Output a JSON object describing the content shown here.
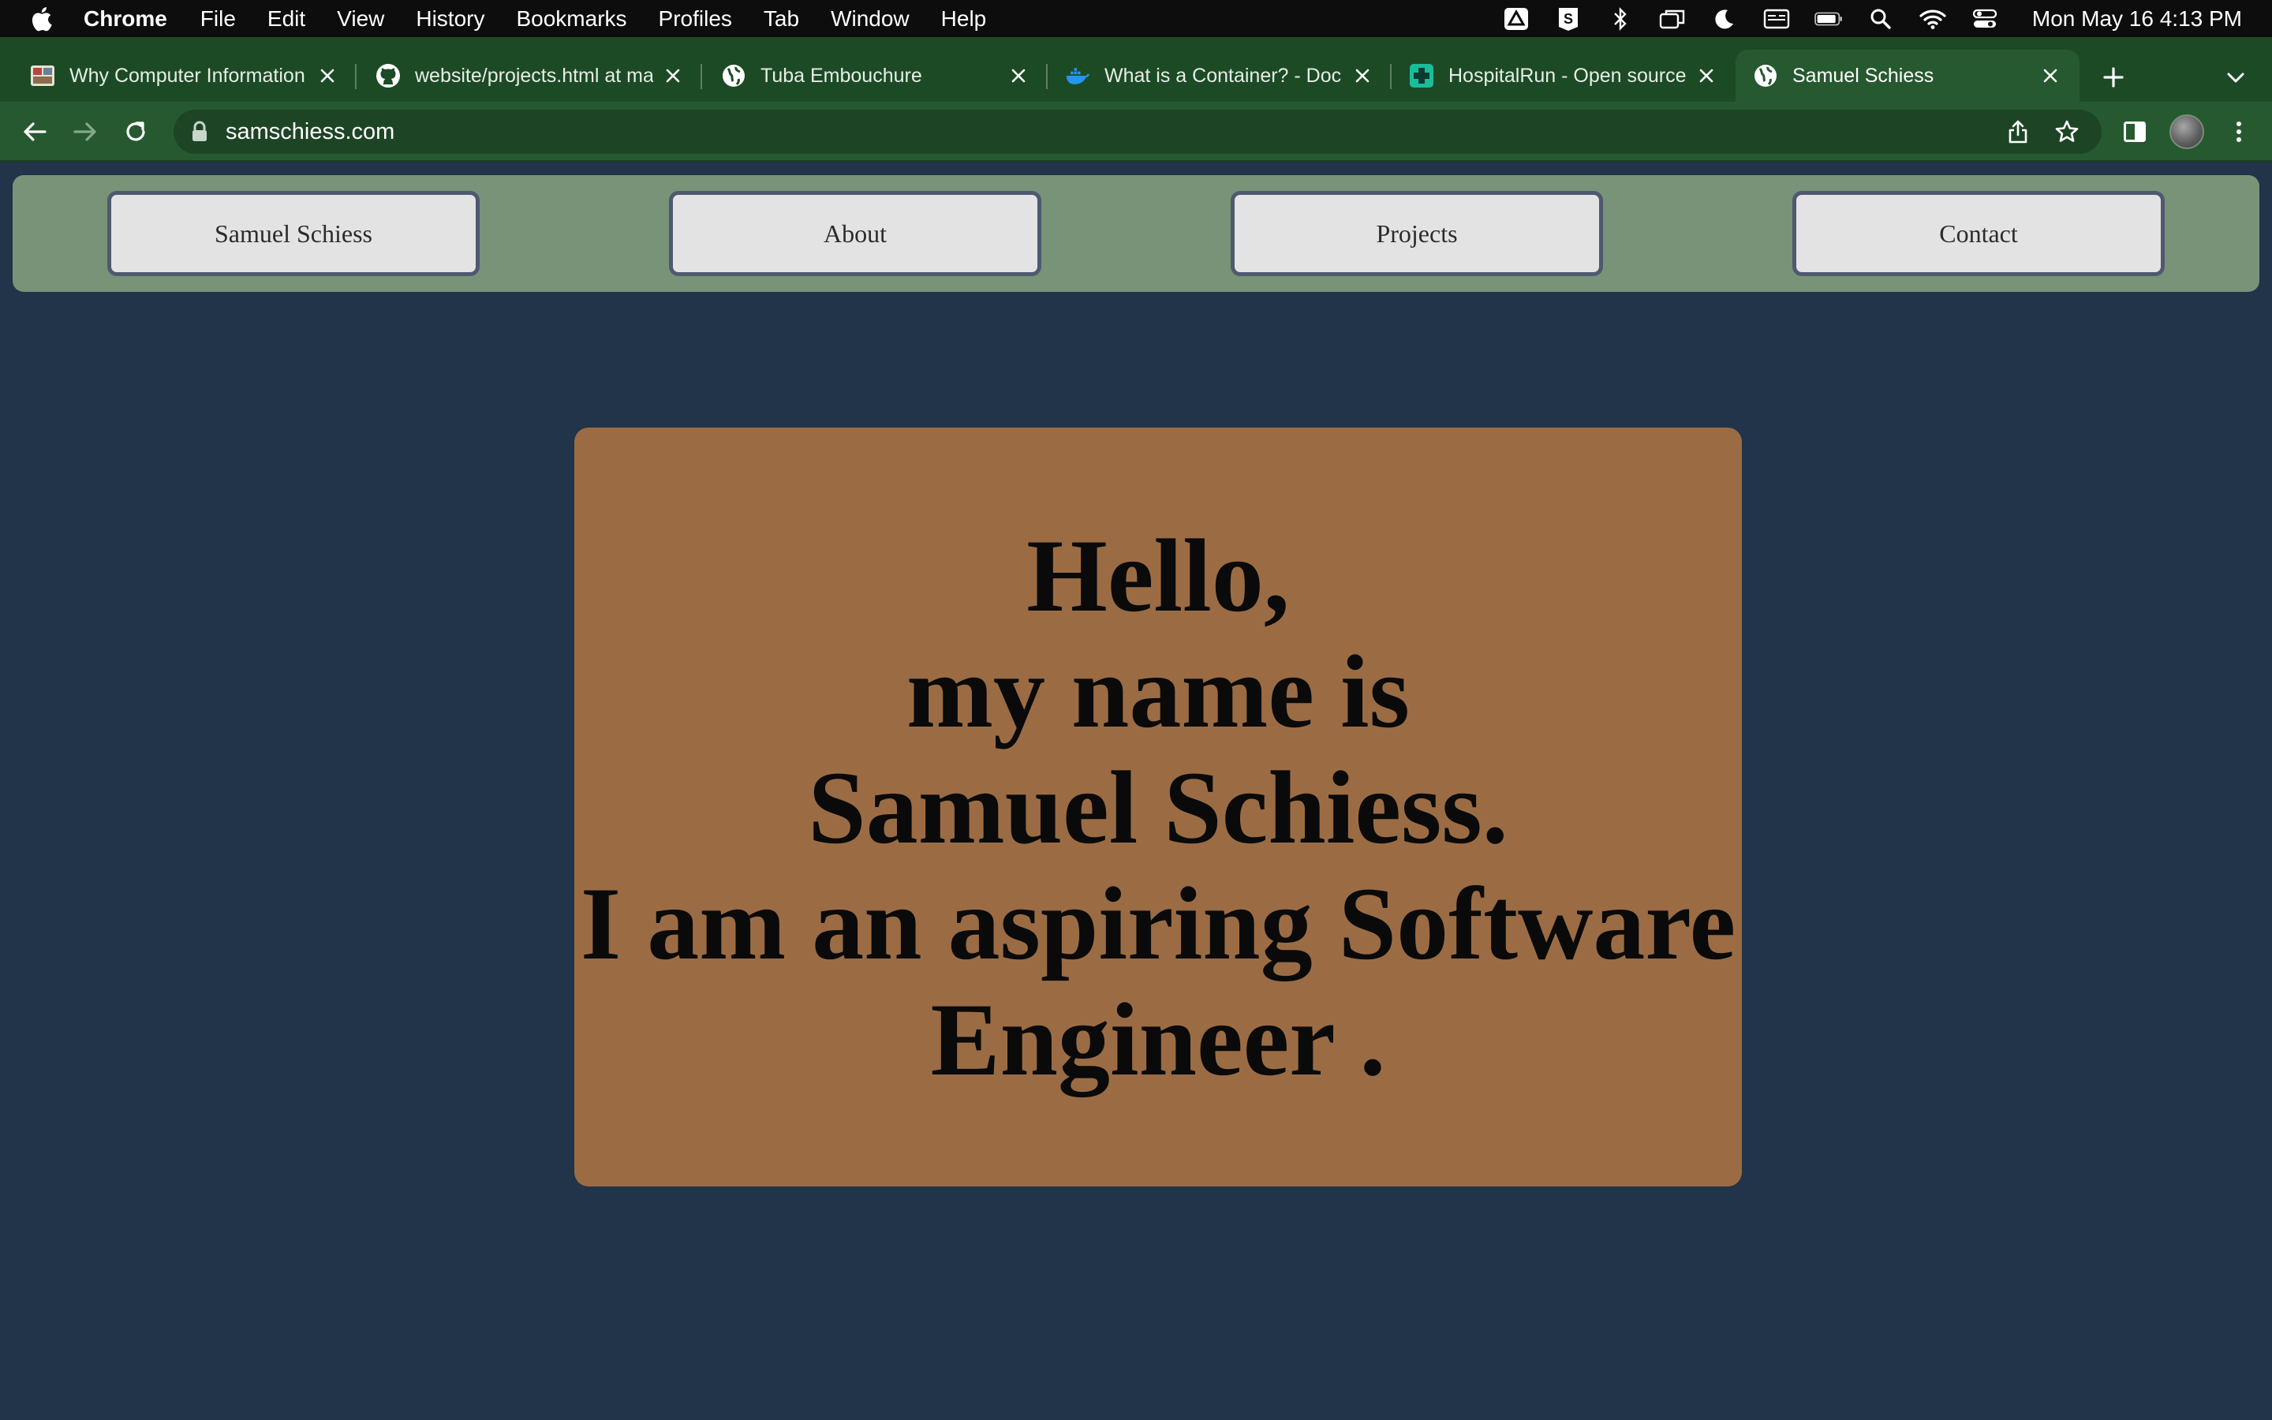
{
  "menubar": {
    "app_name": "Chrome",
    "items": [
      "File",
      "Edit",
      "View",
      "History",
      "Bookmarks",
      "Profiles",
      "Tab",
      "Window",
      "Help"
    ],
    "status_icons": [
      "drive-icon",
      "scrivener-icon",
      "bluetooth-icon",
      "screen-mirror-icon",
      "focus-moon-icon",
      "keyboard-input-icon",
      "battery-icon",
      "spotlight-search-icon",
      "wifi-icon",
      "control-center-icon"
    ],
    "clock": "Mon May 16  4:13 PM"
  },
  "tabs": [
    {
      "title": "Why Computer Information",
      "favicon": "image-thumbnail-icon",
      "active": false
    },
    {
      "title": "website/projects.html at ma",
      "favicon": "github-icon",
      "active": false
    },
    {
      "title": "Tuba Embouchure",
      "favicon": "globe-icon",
      "active": false
    },
    {
      "title": "What is a Container? - Doc",
      "favicon": "docker-whale-icon",
      "active": false
    },
    {
      "title": "HospitalRun - Open source",
      "favicon": "hospitalrun-cross-icon",
      "active": false
    },
    {
      "title": "Samuel Schiess",
      "favicon": "globe-icon",
      "active": true
    }
  ],
  "toolbar": {
    "url": "samschiess.com"
  },
  "colors": {
    "page_bg": "#213449",
    "nav_bg": "#789377",
    "button_bg": "#e3e3e3",
    "button_border": "#4e5970",
    "hero_bg": "#9b6c44",
    "chrome_frame": "#1c4a25",
    "chrome_toolbar": "#26592f"
  },
  "site": {
    "nav": [
      "Samuel Schiess",
      "About",
      "Projects",
      "Contact"
    ],
    "hero_lines": [
      "Hello,",
      "my name is",
      "Samuel Schiess.",
      "I am an aspiring Software",
      "Engineer ."
    ]
  }
}
